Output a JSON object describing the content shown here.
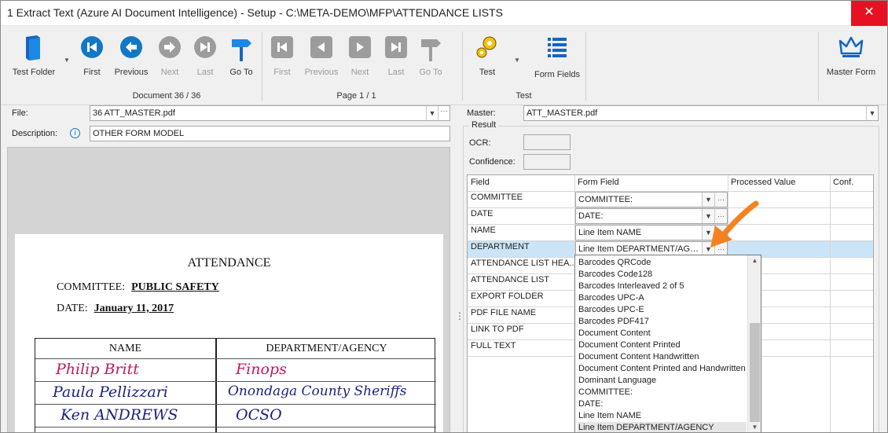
{
  "window": {
    "title": "1 Extract Text (Azure AI Document Intelligence) - Setup - C:\\META-DEMO\\MFP\\ATTENDANCE LISTS",
    "close_glyph": "✕"
  },
  "ribbon": {
    "test_folder": "Test Folder",
    "doc_nav": {
      "first": "First",
      "previous": "Previous",
      "next": "Next",
      "last": "Last",
      "goto": "Go To"
    },
    "page_nav": {
      "first": "First",
      "previous": "Previous",
      "next": "Next",
      "last": "Last",
      "goto": "Go To"
    },
    "test": "Test",
    "form_fields": "Form Fields",
    "master_form": "Master Form",
    "group_document": "Document 36 / 36",
    "group_page": "Page 1 / 1",
    "group_test": "Test"
  },
  "left": {
    "file_label": "File:",
    "file_value": "36 ATT_MASTER.pdf",
    "description_label": "Description:",
    "description_value": "OTHER FORM MODEL"
  },
  "right": {
    "master_label": "Master:",
    "master_value": "ATT_MASTER.pdf",
    "result_legend": "Result",
    "ocr_label": "OCR:",
    "confidence_label": "Confidence:"
  },
  "grid": {
    "headers": [
      "Field",
      "Form Field",
      "Processed Value",
      "Conf."
    ],
    "rows": [
      {
        "field": "COMMITTEE",
        "form_field": "COMMITTEE:"
      },
      {
        "field": "DATE",
        "form_field": "DATE:"
      },
      {
        "field": "NAME",
        "form_field": "Line Item NAME"
      },
      {
        "field": "DEPARTMENT",
        "form_field": "Line Item DEPARTMENT/AGEN..."
      },
      {
        "field": "ATTENDANCE LIST HEA...",
        "form_field": ""
      },
      {
        "field": "ATTENDANCE LIST",
        "form_field": ""
      },
      {
        "field": "EXPORT FOLDER",
        "form_field": ""
      },
      {
        "field": "PDF FILE NAME",
        "form_field": ""
      },
      {
        "field": "LINK TO PDF",
        "form_field": ""
      },
      {
        "field": "FULL TEXT",
        "form_field": ""
      }
    ]
  },
  "dropdown_options": [
    "Barcodes QRCode",
    "Barcodes Code128",
    "Barcodes Interleaved 2 of 5",
    "Barcodes UPC-A",
    "Barcodes UPC-E",
    "Barcodes PDF417",
    "Document Content",
    "Document Content Printed",
    "Document Content Handwritten",
    "Document Content Printed and Handwritten",
    "Dominant Language",
    "COMMITTEE:",
    "DATE:",
    "Line Item NAME",
    "Line Item DEPARTMENT/AGENCY"
  ],
  "document": {
    "heading": "ATTENDANCE",
    "committee_label": "COMMITTEE:",
    "committee_value": "PUBLIC SAFETY",
    "date_label": "DATE:",
    "date_value": "January 11, 2017",
    "col_name": "NAME",
    "col_dept": "DEPARTMENT/AGENCY",
    "handwriting": [
      {
        "name": "Philip Britt",
        "dept": "Finops",
        "color": "#c2185b"
      },
      {
        "name": "Paula Pellizzari",
        "dept": "Onondaga County Sheriffs",
        "color": "#1a237e"
      },
      {
        "name": "Ken ANDREWS",
        "dept": "OCSO",
        "color": "#1a237e"
      }
    ]
  },
  "colors": {
    "accent_blue": "#1277c4",
    "selection": "#cce4f7",
    "arrow": "#f58220",
    "close_red": "#e81123"
  }
}
